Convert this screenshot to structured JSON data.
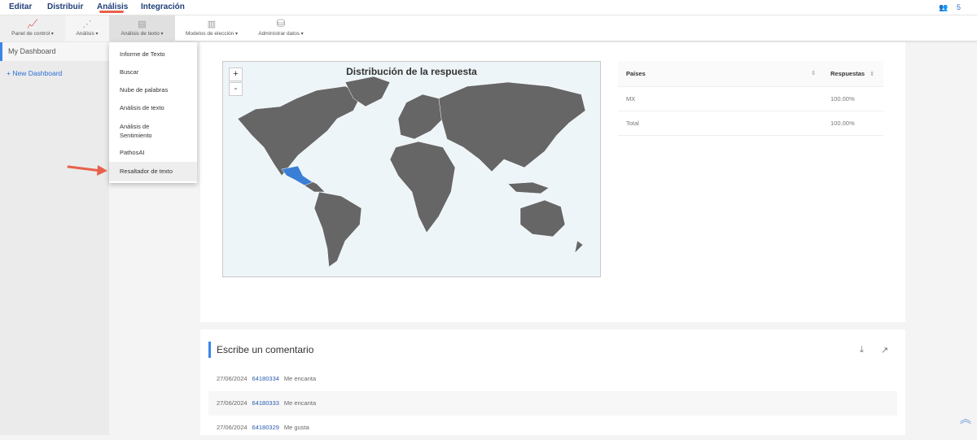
{
  "top_menu": [
    "Editar",
    "Distribuir",
    "Análisis",
    "Integración"
  ],
  "users": {
    "icon": "users-icon",
    "count": "5"
  },
  "toolbar": [
    {
      "label": "Panel de control",
      "icon": "line-chart-icon"
    },
    {
      "label": "Análisis",
      "icon": "scatter-chart-icon"
    },
    {
      "label": "Análisis de texto",
      "icon": "text-document-icon"
    },
    {
      "label": "Modelos de elección",
      "icon": "bar-chart-icon"
    },
    {
      "label": "Administrar datos",
      "icon": "database-icon"
    }
  ],
  "sidebar": {
    "dashboard": "My Dashboard",
    "new": "+ New Dashboard"
  },
  "dropdown": [
    "Informe de Texto",
    "Buscar",
    "Nube de palabras",
    "Análisis de texto",
    "Análisis de Sentimiento",
    "PathosAI",
    "Resaltador de texto"
  ],
  "map": {
    "title": "Distribución de la respuesta",
    "zoom_in": "+",
    "zoom_out": "-",
    "highlight_color": "#3a7fd5"
  },
  "table": {
    "headers": [
      "Países",
      "Respuestas"
    ],
    "rows": [
      [
        "MX",
        "100.00%"
      ],
      [
        "Total",
        "100.00%"
      ]
    ]
  },
  "comments": {
    "title": "Escribe un comentario",
    "rows": [
      {
        "date": "27/06/2024",
        "id": "64180334",
        "text": "Me encanta"
      },
      {
        "date": "27/06/2024",
        "id": "64180333",
        "text": "Me encanta"
      },
      {
        "date": "27/06/2024",
        "id": "64180329",
        "text": "Me gusta"
      }
    ]
  }
}
